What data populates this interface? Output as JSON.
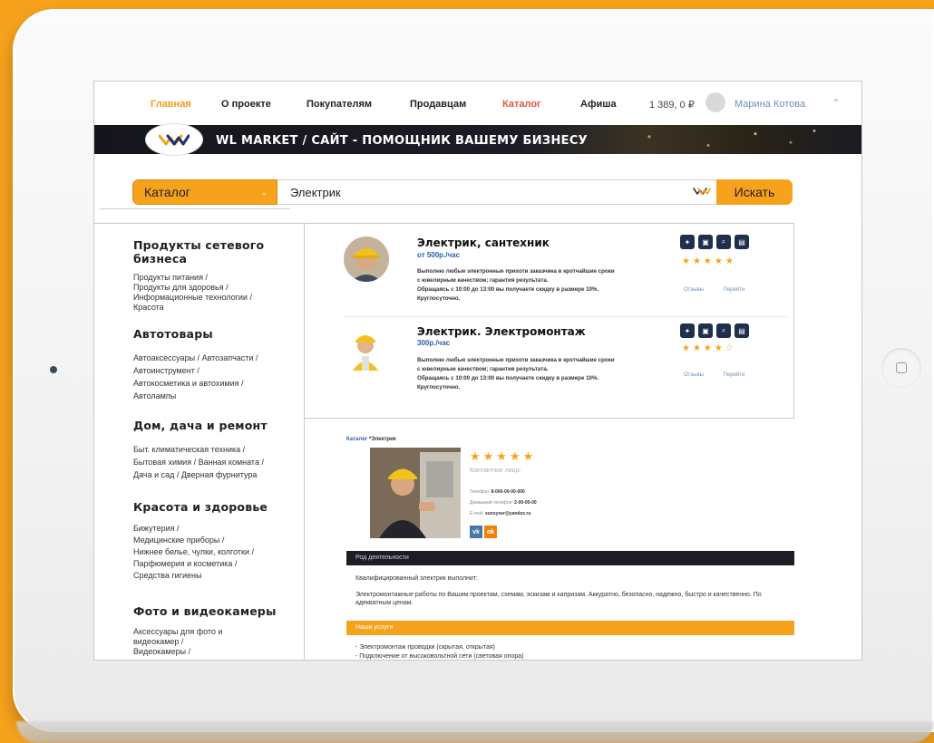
{
  "nav": {
    "home": "Главная",
    "about": "О проекте",
    "buyers": "Покупателям",
    "sellers": "Продавцам",
    "catalog": "Каталог",
    "poster": "Афиша",
    "balance": "1 389, 0 ₽",
    "username": "Марина Котова"
  },
  "banner": {
    "title": "WL MARKET / САЙТ - ПОМОЩНИК ВАШЕМУ БИЗНЕСУ"
  },
  "search": {
    "category": "Каталог",
    "query": "Электрик",
    "button": "Искать"
  },
  "sidebar": [
    {
      "title": "Продукты сетевого бизнеса",
      "links": [
        "Продукты питания /",
        "Продукты для здоровья /",
        "Информационные технологии /",
        "Красота"
      ]
    },
    {
      "title": "Автотовары",
      "links": [
        "Автоаксессуары /",
        "Автозапчасти /",
        "Автоинструмент /",
        "Автокосметика и автохимия /",
        "Автолампы"
      ]
    },
    {
      "title": "Дом, дача и ремонт",
      "links": [
        "Быт. климатическая техника /",
        "Бытовая химия /",
        "Ванная комната /",
        "Дача и сад /",
        "Дверная фурнитура"
      ]
    },
    {
      "title": "Красота и здоровье",
      "links": [
        "Бижутерия /",
        "Медицинские приборы /",
        "Нижнее белье, чулки, колготки /",
        "Парфюмерия и косметика /",
        "Средства гигиены"
      ]
    },
    {
      "title": "Фото и видеокамеры",
      "links": [
        "Аксессуары для фото и видеокамер /",
        "Видеокамеры /"
      ]
    }
  ],
  "listings": [
    {
      "title": "Электрик, сантехник",
      "price": "от 500р./час",
      "desc1": "Выполню любые электронные прихоти заказчика в кротчайшие сроки",
      "desc2": "с ювелирным качеством; гарантия результата.",
      "desc3": "Обращаясь с 10:00 до 13:00 вы получаете скидку в размере 10%.",
      "desc4": "Круглосуточно.",
      "stars": "★★★★★",
      "reviews": "Отзывы",
      "goto": "Перейти"
    },
    {
      "title": "Электрик. Электромонтаж",
      "price": "300р./час",
      "desc1": "Выполню любые электронные прихоти заказчика в кротчайшие сроки",
      "desc2": "с ювелирным качеством; гарантия результата.",
      "desc3": "Обращаясь с 10:00 до 13:00 вы получаете скидку в размере 10%.",
      "desc4": "Круглосуточно.",
      "stars": "★★★★☆",
      "reviews": "Отзывы",
      "goto": "Перейти"
    }
  ],
  "detail": {
    "crumb_root": "Каталог",
    "crumb_leaf": "*Электрик",
    "stars": "★★★★★",
    "contact_label": "Контактное лицо:",
    "phone_label": "Телефон:",
    "phone": "8-000-00-00-000",
    "home_phone_label": "Домашний телефон:",
    "home_phone": "2-00-00-00",
    "email_label": "E-mail:",
    "email": "sunsyser@yandex.ru",
    "vk": "vk",
    "ok": "ok",
    "activity_header": "Род деятельности",
    "activity_intro": "Квалифицированный электрик выполнит:",
    "activity_body": "Электромонтажные работы по Вашим проектам, схемам, эскизам и капризам. Аккуратно, безопасно, надежно, быстро и качественно. По адекватным ценам.",
    "services_header": "Наши услуги",
    "service1": "- Электромонтаж проводки (скрытая, открытая)",
    "service2": "- Подключение от высоковольтной сети (световая опора)"
  },
  "colors": {
    "accent": "#f6a21c",
    "dark": "#1d1d25",
    "link": "#2b5ea8"
  }
}
